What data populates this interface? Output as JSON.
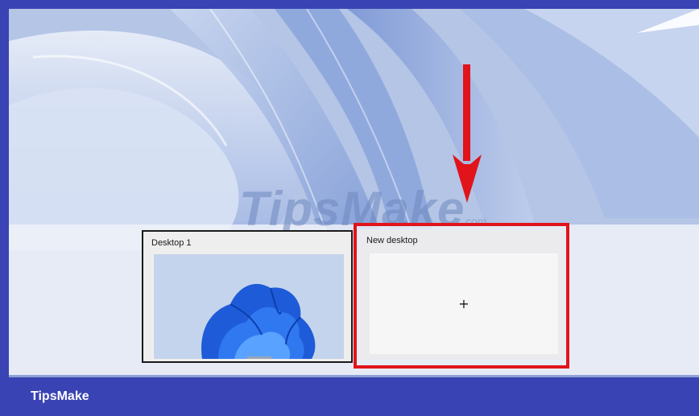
{
  "watermark": {
    "text": "TipsMake",
    "suffix": ".com"
  },
  "task_view": {
    "desktops": [
      {
        "label": "Desktop 1"
      },
      {
        "label": "New desktop",
        "action_icon": "plus-icon",
        "action_glyph": "+"
      }
    ]
  },
  "annotation": {
    "highlight_color": "#e0141a",
    "arrow_icon": "down-arrow-icon"
  },
  "footer": {
    "brand": "TipsMake",
    "background": "#3a43b3"
  }
}
